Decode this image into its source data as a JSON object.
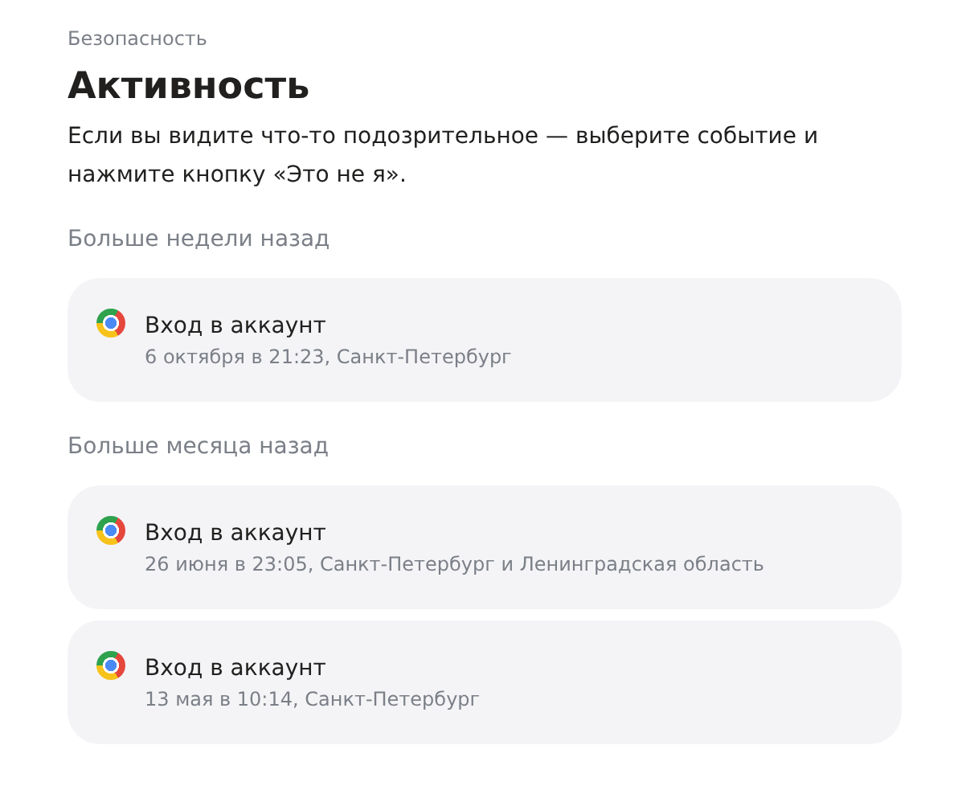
{
  "breadcrumb": "Безопасность",
  "title": "Активность",
  "description": "Если вы видите что-то подозрительное — выберите событие и нажмите кнопку «Это не я».",
  "groups": [
    {
      "label": "Больше недели назад",
      "events": [
        {
          "kind": "chrome",
          "title": "Вход в аккаунт",
          "details": "6 октября в 21:23, Санкт-Петербург"
        }
      ]
    },
    {
      "label": "Больше месяца назад",
      "events": [
        {
          "kind": "chrome",
          "title": "Вход в аккаунт",
          "details": "26 июня в 23:05, Санкт-Петербург и Ленинградская область"
        },
        {
          "kind": "chrome",
          "title": "Вход в аккаунт",
          "details": "13 мая в 10:14, Санкт-Петербург"
        }
      ]
    }
  ]
}
